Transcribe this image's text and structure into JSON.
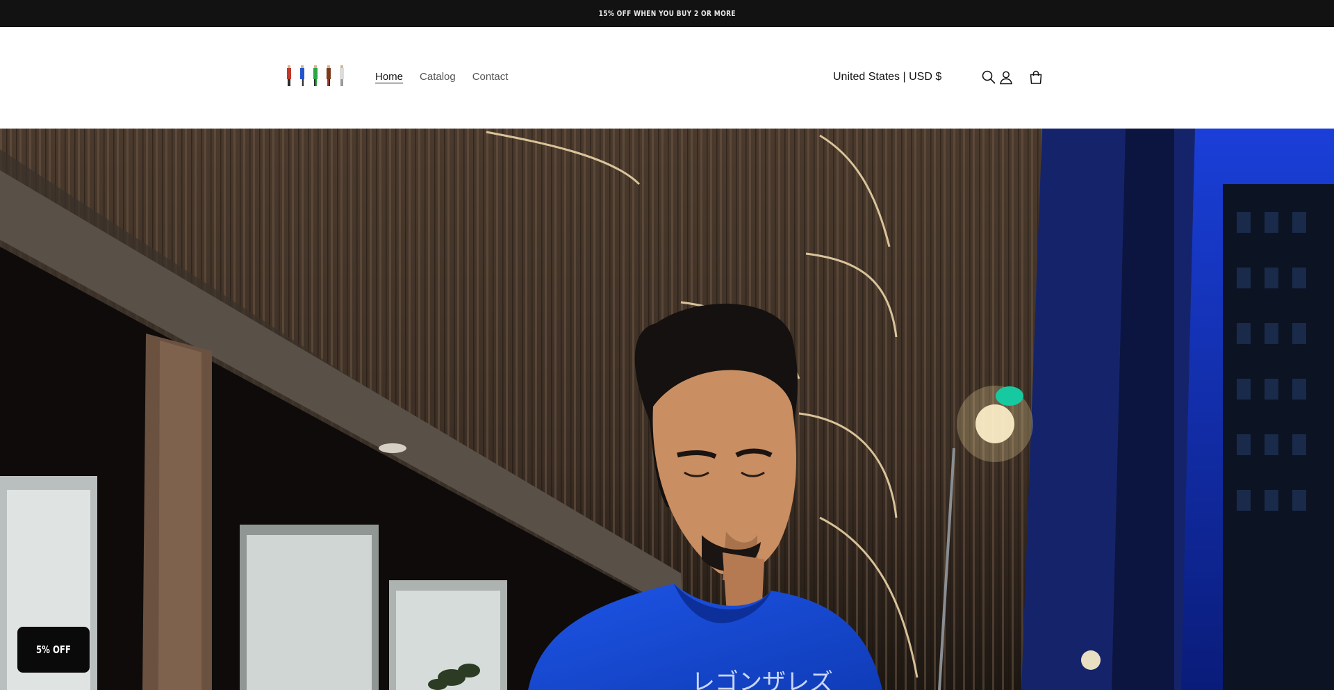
{
  "announcement": {
    "text": "15% OFF WHEN YOU BUY 2 OR MORE"
  },
  "header": {
    "logo_icon": "five-figure-toy-logo",
    "nav": [
      {
        "label": "Home",
        "active": true
      },
      {
        "label": "Catalog",
        "active": false
      },
      {
        "label": "Contact",
        "active": false
      }
    ],
    "locale": "United States | USD $",
    "icons": [
      "search-icon",
      "account-icon",
      "cart-icon"
    ]
  },
  "hero": {
    "image": "man-in-blue-tshirt-night-city-street",
    "shirt_text": "レゴンザレズ"
  },
  "discount_badge": {
    "label": "5% OFF"
  },
  "colors": {
    "announcement_bg": "#121212",
    "text": "#121212",
    "shirt_blue": "#1b4fd6",
    "badge_bg": "#0a0a0a"
  }
}
